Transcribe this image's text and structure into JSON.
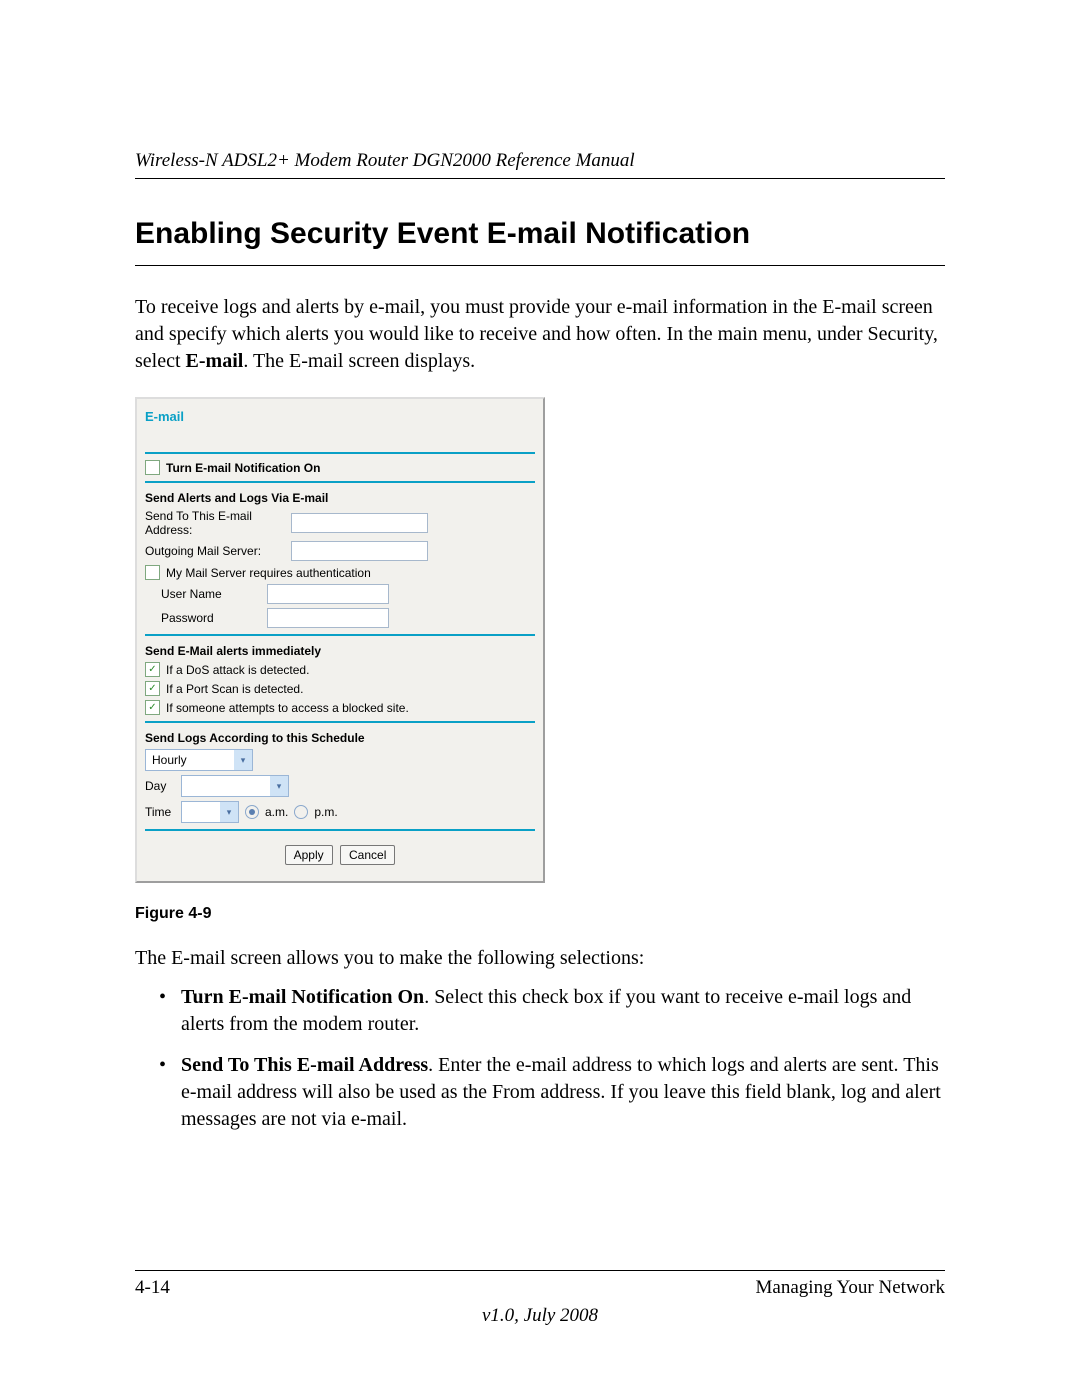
{
  "header": {
    "running_head": "Wireless-N ADSL2+ Modem Router DGN2000 Reference Manual"
  },
  "section": {
    "title": "Enabling Security Event E-mail Notification",
    "intro_pre": "To receive logs and alerts by e-mail, you must provide your e-mail information in the E-mail screen and specify which alerts you would like to receive and how often. In the main menu, under Security, select ",
    "intro_bold": "E-mail",
    "intro_post": ". The E-mail screen displays."
  },
  "panel": {
    "title": "E-mail",
    "turn_on_label": "Turn E-mail Notification On",
    "send_section": "Send Alerts and Logs Via E-mail",
    "send_to_label": "Send To This E-mail Address:",
    "outgoing_label": "Outgoing Mail Server:",
    "auth_label": "My Mail Server requires authentication",
    "user_label": "User Name",
    "pass_label": "Password",
    "alerts_section": "Send E-Mail alerts immediately",
    "alert_dos": "If a DoS attack is detected.",
    "alert_portscan": "If a Port Scan is detected.",
    "alert_blocked": "If someone attempts to access a blocked site.",
    "schedule_section": "Send Logs According to this Schedule",
    "schedule_value": "Hourly",
    "day_label": "Day",
    "time_label": "Time",
    "am_label": "a.m.",
    "pm_label": "p.m.",
    "apply": "Apply",
    "cancel": "Cancel"
  },
  "figure_caption": "Figure 4-9",
  "after_figure": "The E-mail screen allows you to make the following selections:",
  "bullets": [
    {
      "bold": "Turn E-mail Notification On",
      "rest": ". Select this check box if you want to receive e-mail logs and alerts from the modem router."
    },
    {
      "bold": "Send To This E-mail Address",
      "rest": ". Enter the e-mail address to which logs and alerts are sent. This e-mail address will also be used as the From address. If you leave this field blank, log and alert messages are not via e-mail."
    }
  ],
  "footer": {
    "page": "4-14",
    "chapter": "Managing Your Network",
    "version": "v1.0, July 2008"
  }
}
